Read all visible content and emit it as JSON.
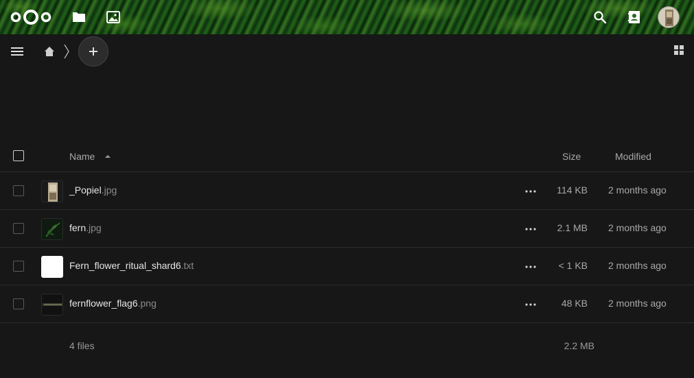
{
  "header": {
    "logo": "nextcloud-logo",
    "apps": [
      {
        "name": "Files",
        "icon": "folder-icon"
      },
      {
        "name": "Photos",
        "icon": "image-icon"
      }
    ],
    "right_icons": [
      "search-icon",
      "contacts-icon"
    ],
    "avatar": "user-avatar"
  },
  "toolbar": {
    "menu_icon": "hamburger-icon",
    "breadcrumb_home_icon": "home-icon",
    "new_button_icon": "plus-icon",
    "view_toggle_icon": "grid-view-icon"
  },
  "table": {
    "headers": {
      "name": "Name",
      "size": "Size",
      "modified": "Modified"
    },
    "sort": {
      "column": "name",
      "direction": "ascending"
    },
    "files": [
      {
        "basename": "_Popiel",
        "ext": ".jpg",
        "size": "114 KB",
        "modified": "2 months ago",
        "thumb": "photo-portrait"
      },
      {
        "basename": "fern",
        "ext": ".jpg",
        "size": "2.1 MB",
        "modified": "2 months ago",
        "thumb": "photo-fern"
      },
      {
        "basename": "Fern_flower_ritual_shard6",
        "ext": ".txt",
        "size": "< 1 KB",
        "modified": "2 months ago",
        "thumb": "text-file"
      },
      {
        "basename": "fernflower_flag6",
        "ext": ".png",
        "size": "48 KB",
        "modified": "2 months ago",
        "thumb": "image-banner"
      }
    ],
    "summary": {
      "count": "4 files",
      "total_size": "2.2 MB"
    }
  },
  "colors": {
    "background": "#171717",
    "text": "#e6e6e6",
    "muted": "#a9a9a9",
    "divider": "#2d2d2d"
  }
}
